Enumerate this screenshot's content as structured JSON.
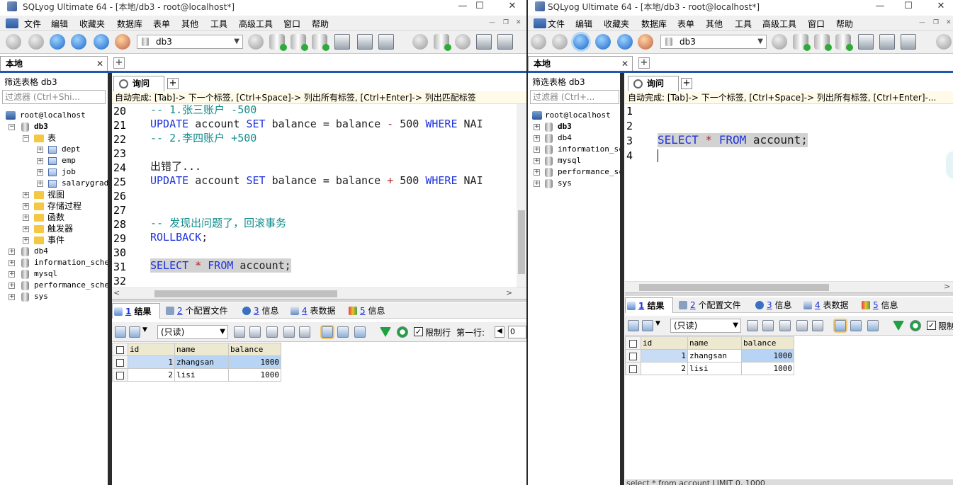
{
  "colors": {
    "keyword": "#1e32dc",
    "comment": "#138c8c",
    "operator": "#b02020",
    "tab_accent": "#1e5aa8",
    "highlight": "#d2d2d2"
  },
  "left": {
    "title": "SQLyog Ultimate 64 - [本地/db3 - root@localhost*]",
    "menu": [
      "文件",
      "编辑",
      "收藏夹",
      "数据库",
      "表单",
      "其他",
      "工具",
      "高级工具",
      "窗口",
      "帮助"
    ],
    "db_selector": "db3",
    "object_tab": "本地",
    "filter_label": "筛选表格 db3",
    "filter_placeholder": "过滤器 (Ctrl+Shi...",
    "tree": {
      "root": "root@localhost",
      "db3": "db3",
      "tables_folder": "表",
      "tables": [
        "dept",
        "emp",
        "job",
        "salarygrade"
      ],
      "folders": [
        "视图",
        "存储过程",
        "函数",
        "触发器",
        "事件"
      ],
      "dbs": [
        "db4",
        "information_schema",
        "mysql",
        "performance_schema",
        "sys"
      ]
    },
    "query_tab": "询问",
    "autocomplete": "自动完成: [Tab]-> 下一个标签, [Ctrl+Space]-> 列出所有标签, [Ctrl+Enter]-> 列出匹配标签",
    "editor": {
      "line_numbers": [
        "20",
        "21",
        "22",
        "23",
        "24",
        "25",
        "26",
        "27",
        "28",
        "29",
        "30",
        "31",
        "32"
      ],
      "l20": "-- 1.张三账户 -500",
      "l21": {
        "kw1": "UPDATE",
        "t1": " account ",
        "kw2": "SET",
        "t2": " balance = balance ",
        "op": "-",
        "t3": " 500 ",
        "kw3": "WHERE",
        "t4": " NAI"
      },
      "l22": "-- 2.李四账户 +500",
      "l24": "出错了...",
      "l25": {
        "kw1": "UPDATE",
        "t1": " account ",
        "kw2": "SET",
        "t2": " balance = balance ",
        "op": "+",
        "t3": " 500 ",
        "kw3": "WHERE",
        "t4": " NAI"
      },
      "l28": "-- 发现出问题了，回滚事务",
      "l29": {
        "kw": "ROLLBACK",
        "t": ";"
      },
      "l31": {
        "kw1": "SELECT",
        "op": " * ",
        "kw2": "FROM",
        "t": " account;"
      }
    },
    "result_tabs": [
      {
        "num": "1",
        "label": "结果"
      },
      {
        "num": "2",
        "label": "个配置文件"
      },
      {
        "num": "3",
        "label": "信息"
      },
      {
        "num": "4",
        "label": "表数据"
      },
      {
        "num": "5",
        "label": "信息"
      }
    ],
    "readonly": "(只读)",
    "limit_label": "限制行",
    "first_row_label": "第一行:",
    "first_row_value": "0",
    "grid": {
      "columns": [
        "id",
        "name",
        "balance"
      ],
      "rows": [
        [
          "1",
          "zhangsan",
          "1000"
        ],
        [
          "2",
          "lisi",
          "1000"
        ]
      ]
    }
  },
  "right": {
    "title": "SQLyog Ultimate 64 - [本地/db3 - root@localhost*]",
    "menu": [
      "文件",
      "编辑",
      "收藏夹",
      "数据库",
      "表单",
      "其他",
      "工具",
      "高级工具",
      "窗口",
      "帮助"
    ],
    "db_selector": "db3",
    "object_tab": "本地",
    "filter_label": "筛选表格 db3",
    "filter_placeholder": "过滤器 (Ctrl+...",
    "tree": {
      "root": "root@localhost",
      "dbs": [
        "db3",
        "db4",
        "information_sch",
        "mysql",
        "performance_sch",
        "sys"
      ]
    },
    "query_tab": "询问",
    "autocomplete": "自动完成: [Tab]-> 下一个标签, [Ctrl+Space]-> 列出所有标签, [Ctrl+Enter]-...",
    "editor": {
      "line_numbers": [
        "1",
        "2",
        "3",
        "4"
      ],
      "l3": {
        "kw1": "SELECT",
        "op": " * ",
        "kw2": "FROM",
        "t": " account;"
      }
    },
    "result_tabs": [
      {
        "num": "1",
        "label": "结果"
      },
      {
        "num": "2",
        "label": "个配置文件"
      },
      {
        "num": "3",
        "label": "信息"
      },
      {
        "num": "4",
        "label": "表数据"
      },
      {
        "num": "5",
        "label": "信息"
      }
    ],
    "readonly": "(只读)",
    "limit_label": "限制",
    "grid": {
      "columns": [
        "id",
        "name",
        "balance"
      ],
      "rows": [
        [
          "1",
          "zhangsan",
          "1000"
        ],
        [
          "2",
          "lisi",
          "1000"
        ]
      ]
    },
    "status": "select * from account LIMIT 0, 1000"
  }
}
